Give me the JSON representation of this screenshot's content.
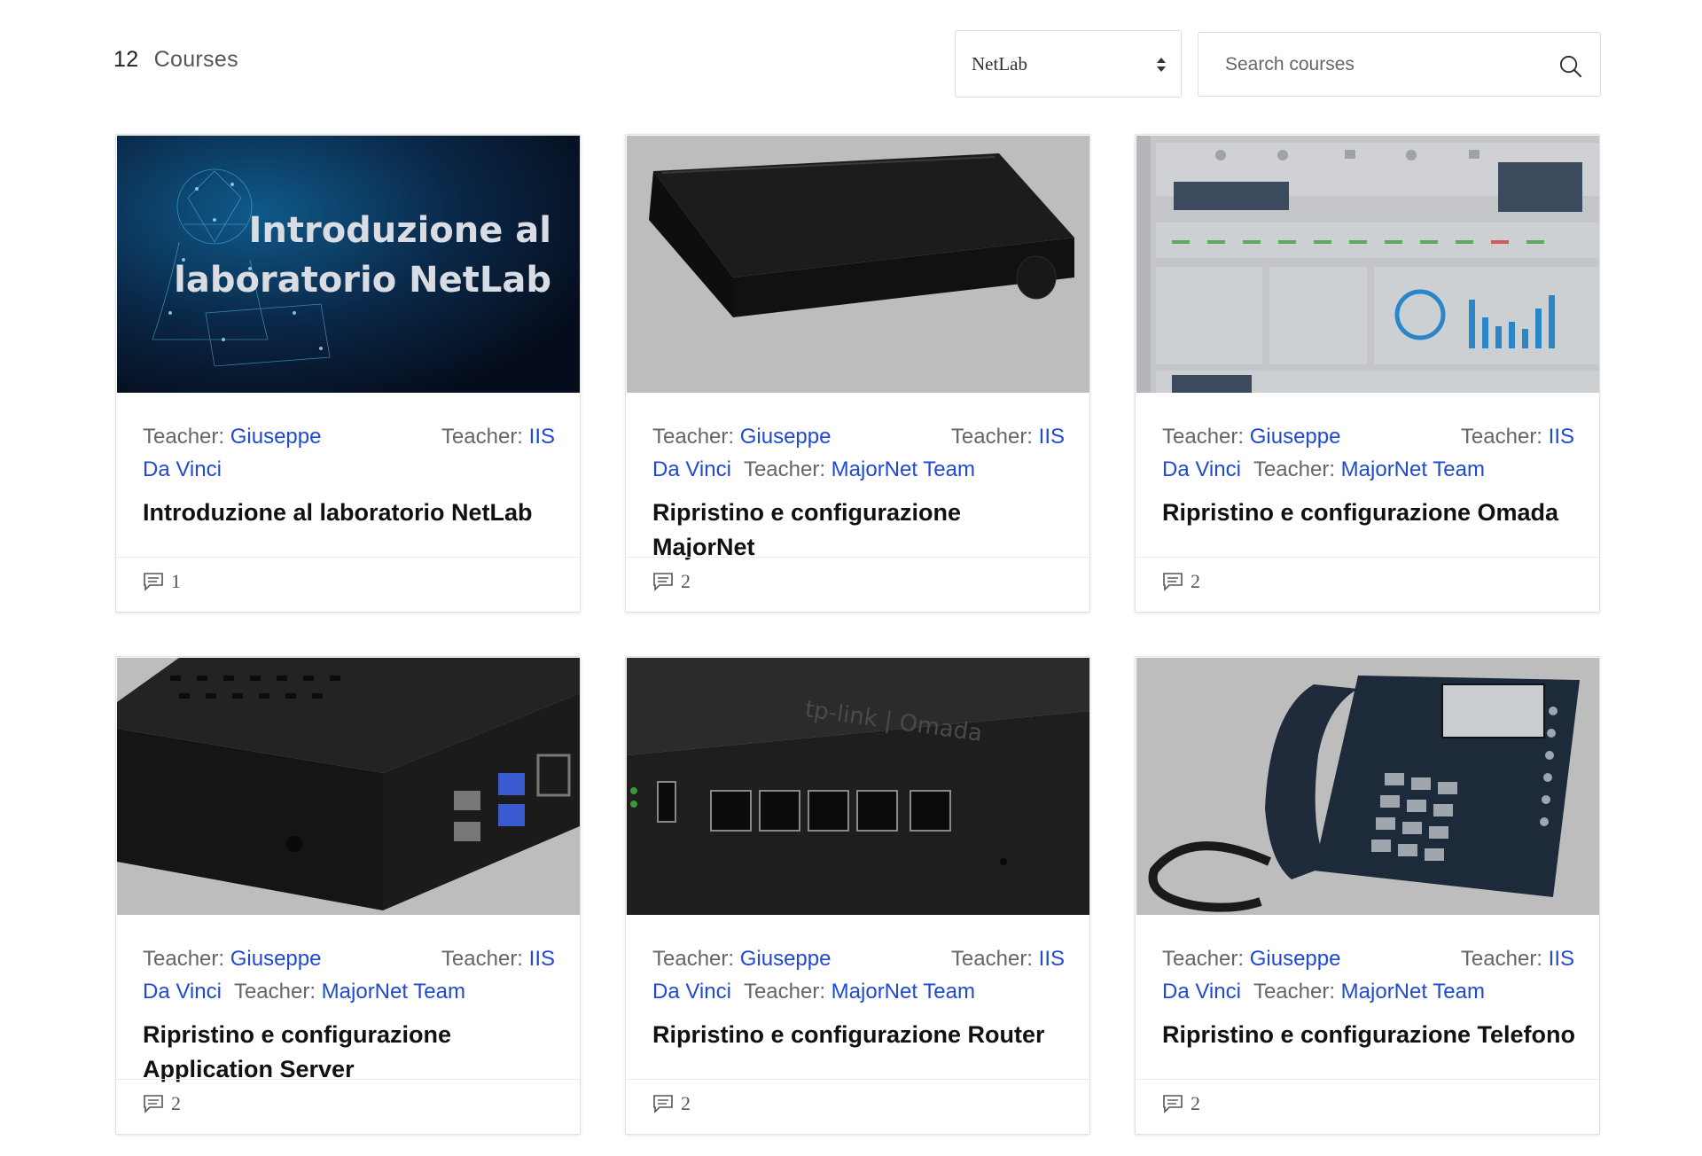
{
  "header": {
    "course_count": "12",
    "course_count_label": "Courses",
    "category_selected": "NetLab",
    "search_placeholder": "Search courses"
  },
  "labels": {
    "teacher": "Teacher:"
  },
  "courses": [
    {
      "title": "Introduzione al laboratorio NetLab",
      "image": "netlab-intro-banner",
      "image_text": [
        "Introduzione al",
        "laboratorio NetLab"
      ],
      "teachers": [
        "Giuseppe",
        "Da Vinci",
        "IIS"
      ],
      "comments": "1"
    },
    {
      "title": "Ripristino e configurazione MajorNet",
      "image": "black-server-box",
      "teachers": [
        "Giuseppe",
        "Da Vinci",
        "IIS",
        "MajorNet Team"
      ],
      "comments": "2"
    },
    {
      "title": "Ripristino e configurazione Omada",
      "image": "omada-dashboard-screenshot",
      "teachers": [
        "Giuseppe",
        "Da Vinci",
        "IIS",
        "MajorNet Team"
      ],
      "comments": "2"
    },
    {
      "title": "Ripristino e configurazione Application Server",
      "image": "raspberry-pi-case",
      "teachers": [
        "Giuseppe",
        "Da Vinci",
        "IIS",
        "MajorNet Team"
      ],
      "comments": "2"
    },
    {
      "title": "Ripristino e configurazione Router",
      "image": "tp-link-omada-router",
      "image_text": [
        "tp-link | Omada"
      ],
      "teachers": [
        "Giuseppe",
        "Da Vinci",
        "IIS",
        "MajorNet Team"
      ],
      "comments": "2"
    },
    {
      "title": "Ripristino e configurazione Telefono",
      "image": "ip-desk-phone",
      "teachers": [
        "Giuseppe",
        "Da Vinci",
        "IIS",
        "MajorNet Team"
      ],
      "comments": "2"
    }
  ],
  "colors": {
    "link": "#1f4ad1",
    "card_border": "#e2e2e2",
    "image_dim": "#bdbdbd"
  }
}
